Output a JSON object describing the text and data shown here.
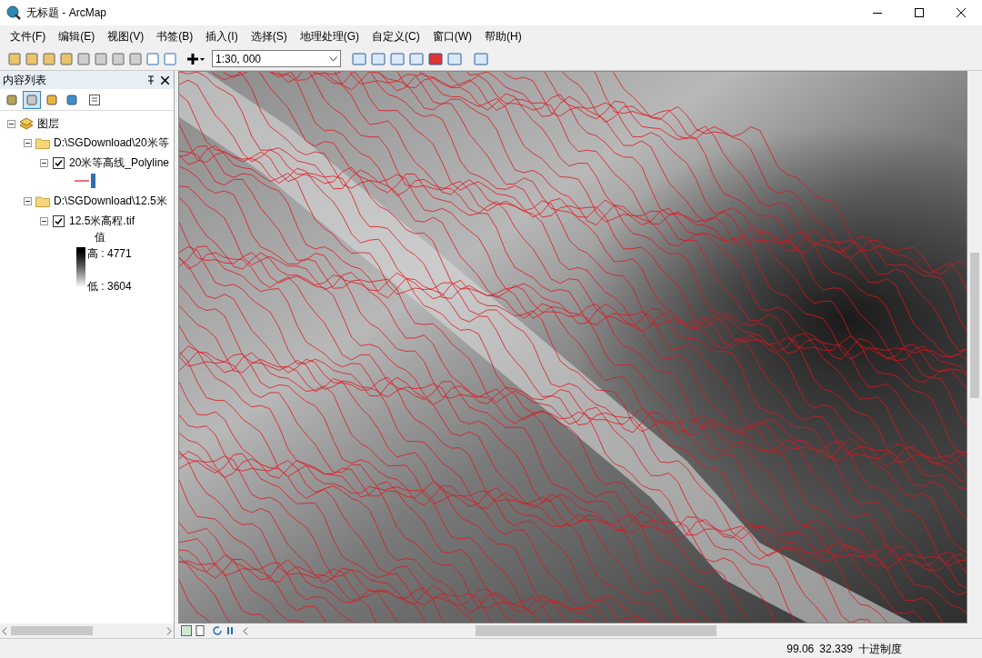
{
  "window": {
    "title": "无标题 - ArcMap"
  },
  "menu": [
    "文件(F)",
    "编辑(E)",
    "视图(V)",
    "书签(B)",
    "插入(I)",
    "选择(S)",
    "地理处理(G)",
    "自定义(C)",
    "窗口(W)",
    "帮助(H)"
  ],
  "toolbar": {
    "scale": "1:30, 000"
  },
  "toc": {
    "title": "内容列表",
    "views": [
      {
        "selected": false
      },
      {
        "selected": true
      },
      {
        "selected": false
      },
      {
        "selected": false
      }
    ],
    "root": {
      "label": "图层",
      "expanded": true,
      "children": [
        {
          "label": "D:\\SGDownload\\20米等",
          "expanded": true,
          "layers": [
            {
              "label": "20米等高线_Polyline",
              "checked": true,
              "expanded": true,
              "kind": "line"
            }
          ]
        },
        {
          "label": "D:\\SGDownload\\12.5米",
          "expanded": true,
          "layers": [
            {
              "label": "12.5米高程.tif",
              "checked": true,
              "expanded": true,
              "kind": "raster",
              "legend": {
                "title": "值",
                "high": "高 : 4771",
                "low": "低 : 3604"
              }
            }
          ]
        }
      ]
    }
  },
  "status": [
    "99.06",
    "32.339",
    "十进制度"
  ]
}
